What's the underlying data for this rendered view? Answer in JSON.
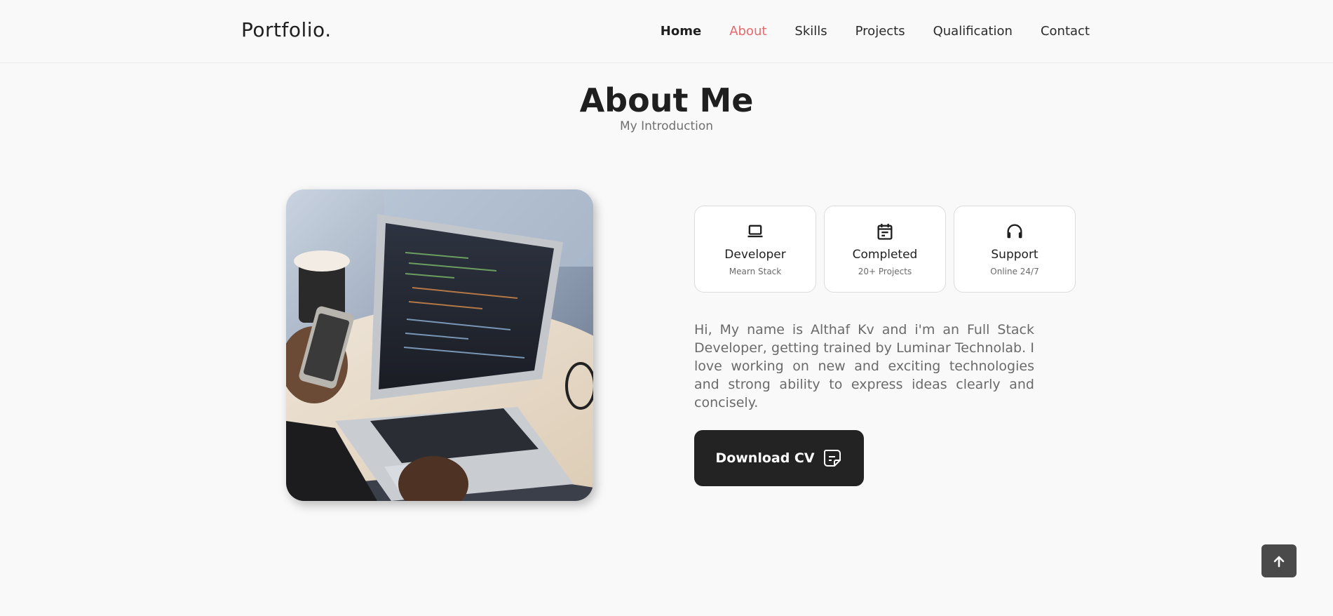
{
  "header": {
    "logo": "Portfolio.",
    "nav": [
      {
        "label": "Home"
      },
      {
        "label": "About"
      },
      {
        "label": "Skills"
      },
      {
        "label": "Projects"
      },
      {
        "label": "Qualification"
      },
      {
        "label": "Contact"
      }
    ]
  },
  "about": {
    "title": "About Me",
    "subtitle": "My Introduction",
    "cards": [
      {
        "icon": "laptop-icon",
        "title": "Developer",
        "sub": "Mearn Stack"
      },
      {
        "icon": "calendar-icon",
        "title": "Completed",
        "sub": "20+ Projects"
      },
      {
        "icon": "headphones-icon",
        "title": "Support",
        "sub": "Online 24/7"
      }
    ],
    "description": "Hi, My name is Althaf Kv and i'm an Full Stack Developer, getting trained by Luminar Technolab. I love working on new and exciting technologies and strong ability to express ideas clearly and concisely.",
    "download_label": "Download CV"
  },
  "colors": {
    "accent": "#e8696b",
    "dark": "#232323",
    "background": "#f9f9f9"
  }
}
